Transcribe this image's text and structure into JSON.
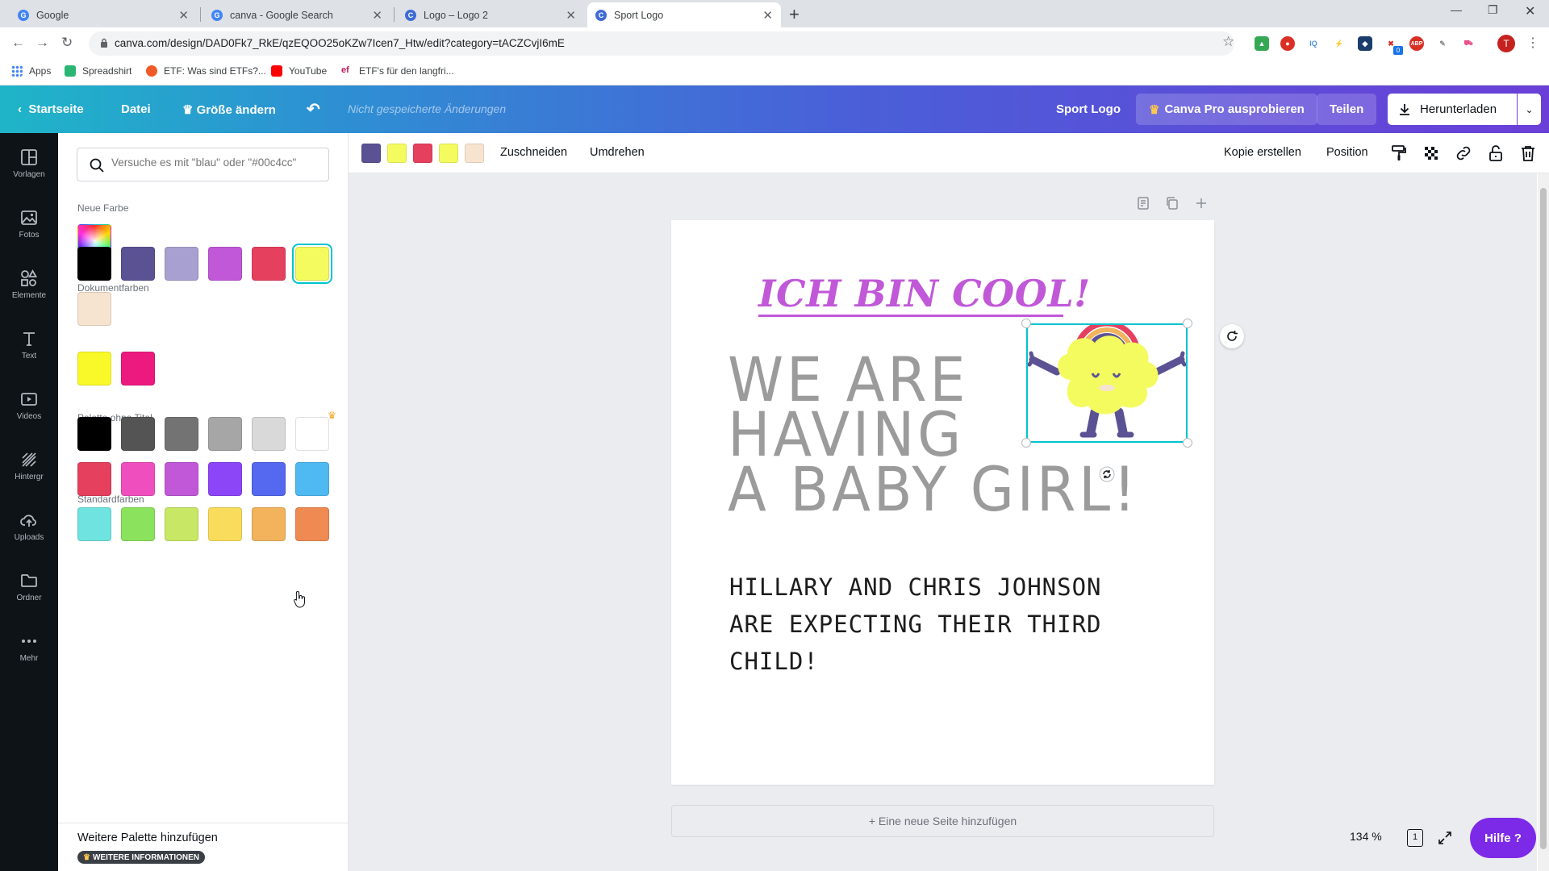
{
  "browser": {
    "tabs": [
      {
        "label": "Google",
        "icon": "google-icon"
      },
      {
        "label": "canva - Google Search",
        "icon": "google-icon"
      },
      {
        "label": "Logo – Logo 2",
        "icon": "canva-icon"
      },
      {
        "label": "Sport Logo",
        "icon": "canva-icon",
        "active": true
      }
    ],
    "url": "canva.com/design/DAD0Fk7_RkE/qzEQOO25oKZw7Icen7_Htw/edit?category=tACZCvjI6mE",
    "bookmarks": [
      "Apps",
      "Spreadshirt",
      "ETF: Was sind ETFs?...",
      "YouTube",
      "ETF's für den langfri..."
    ],
    "profile_initial": "T",
    "extension_badge": "0"
  },
  "header": {
    "home": "Startseite",
    "file": "Datei",
    "resize": "Größe ändern",
    "unsaved": "Nicht gespeicherte Änderungen",
    "design_name": "Sport Logo",
    "pro": "Canva Pro ausprobieren",
    "share": "Teilen",
    "download": "Herunterladen"
  },
  "sidebar": {
    "items": [
      {
        "label": "Vorlagen",
        "icon": "templates-icon"
      },
      {
        "label": "Fotos",
        "icon": "photos-icon"
      },
      {
        "label": "Elemente",
        "icon": "elements-icon"
      },
      {
        "label": "Text",
        "icon": "text-icon"
      },
      {
        "label": "Videos",
        "icon": "videos-icon"
      },
      {
        "label": "Hintergr",
        "icon": "background-icon"
      },
      {
        "label": "Uploads",
        "icon": "uploads-icon"
      },
      {
        "label": "Ordner",
        "icon": "folder-icon"
      },
      {
        "label": "Mehr",
        "icon": "more-icon"
      }
    ]
  },
  "panel": {
    "search_placeholder": "Versuche es mit \"blau\" oder \"#00c4cc\"",
    "new_color_label": "Neue Farbe",
    "doc_colors_label": "Dokumentfarben",
    "doc_colors": [
      "#000000",
      "#5b5294",
      "#a8a0d0",
      "#c058d8",
      "#e5405e",
      "#f4fb5e",
      "#f6e4d0"
    ],
    "doc_selected_index": 5,
    "untitled_label": "Palette ohne Titel",
    "untitled_colors": [
      "#f9f92a",
      "#ec1a7f"
    ],
    "std_label": "Standardfarben",
    "std_colors": [
      "#000000",
      "#545454",
      "#737373",
      "#a6a6a6",
      "#d9d9d9",
      "#ffffff",
      "#e5405e",
      "#ef4fbe",
      "#c058d8",
      "#8c45f7",
      "#5468f0",
      "#4fb9f2",
      "#6fe3e0",
      "#8be25c",
      "#c8e865",
      "#f9dc5c",
      "#f2b35c",
      "#ef8a52"
    ],
    "more_palette": "Weitere Palette hinzufügen",
    "more_info": "WEITERE INFORMATIONEN"
  },
  "toolbar": {
    "colors": [
      "#5b5294",
      "#f4fb5e",
      "#e5405e",
      "#f4fb5e",
      "#f6e4d0"
    ],
    "crop": "Zuschneiden",
    "flip": "Umdrehen",
    "copy": "Kopie erstellen",
    "position": "Position"
  },
  "canvas": {
    "title": "ICH BIN COOL!",
    "line1": "WE ARE",
    "line2": "HAVING",
    "line3": "A BABY GIRL!",
    "sub1": "HILLARY AND CHRIS JOHNSON",
    "sub2": "ARE EXPECTING THEIR THIRD",
    "sub3": "CHILD!",
    "add_page": "+ Eine neue Seite hinzufügen"
  },
  "footer": {
    "zoom": "134 %",
    "page_count": "1",
    "help": "Hilfe ?"
  },
  "colors": {
    "accent": "#00c4cc",
    "purple": "#7d2ae8"
  }
}
